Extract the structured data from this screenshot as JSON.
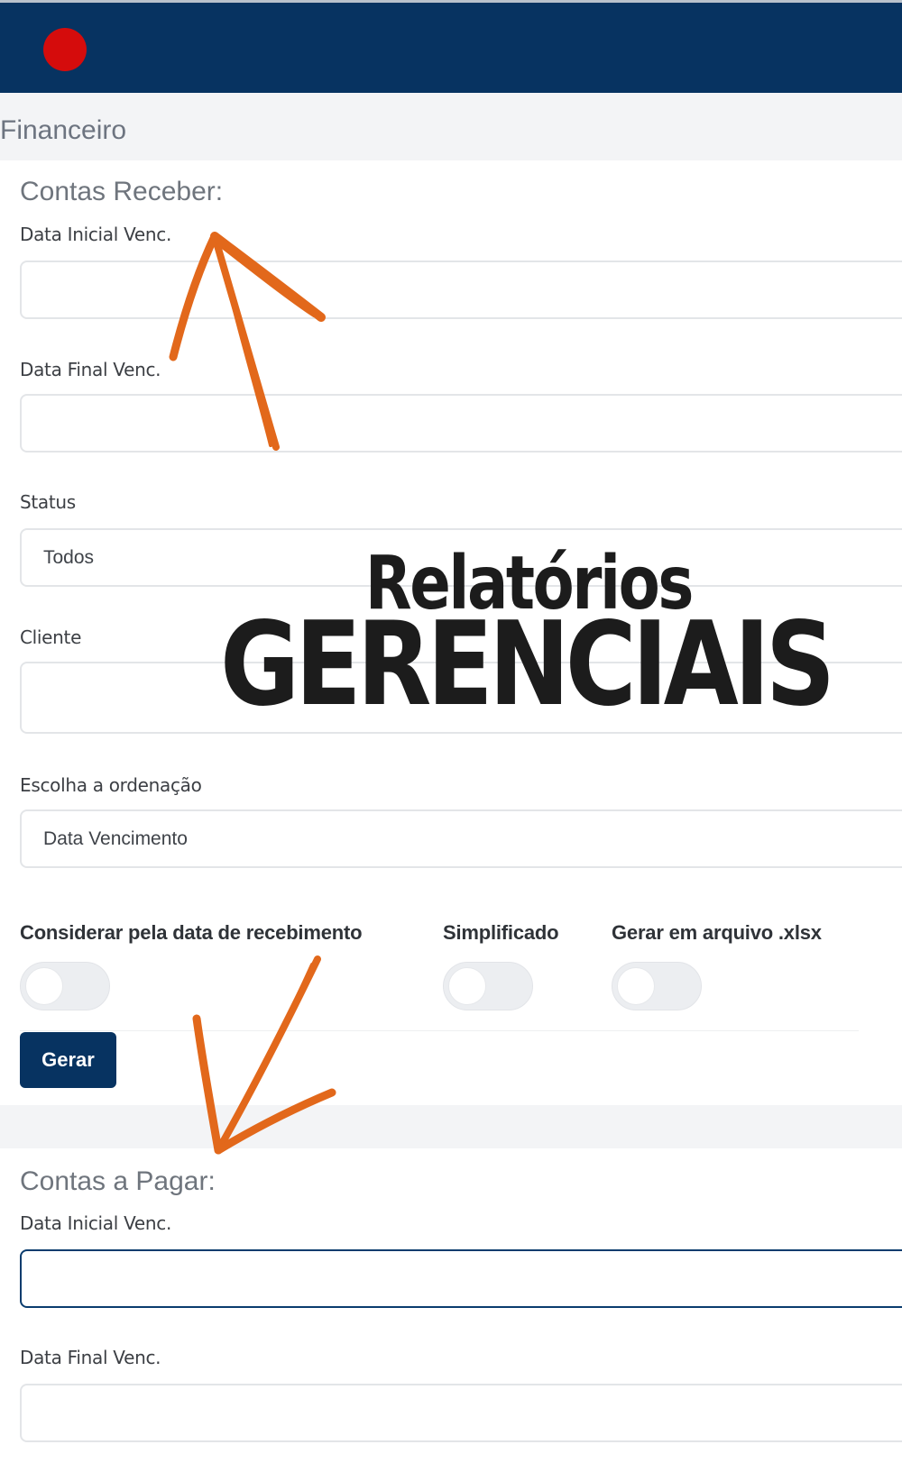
{
  "header": {
    "logo_color": "#d50c0c",
    "bar_color": "#073361"
  },
  "page_title": "Financeiro",
  "receber": {
    "title": "Contas Receber:",
    "data_inicial_label": "Data Inicial Venc.",
    "data_inicial_value": "",
    "data_final_label": "Data Final Venc.",
    "data_final_value": "",
    "status_label": "Status",
    "status_value": "Todos",
    "cliente_label": "Cliente",
    "cliente_value": "",
    "ordenacao_label": "Escolha a ordenação",
    "ordenacao_value": "Data Vencimento",
    "toggles": [
      {
        "label": "Considerar pela data de recebimento",
        "on": false
      },
      {
        "label": "Simplificado",
        "on": false
      },
      {
        "label": "Gerar em arquivo .xlsx",
        "on": false
      }
    ],
    "button_label": "Gerar"
  },
  "pagar": {
    "title": "Contas a Pagar:",
    "data_inicial_label": "Data Inicial Venc.",
    "data_inicial_value": "",
    "data_final_label": "Data Final Venc.",
    "data_final_value": ""
  },
  "overlay": {
    "line1": "Relatórios",
    "line2": "GERENCIAIS",
    "arrow_color": "#e2681b"
  }
}
